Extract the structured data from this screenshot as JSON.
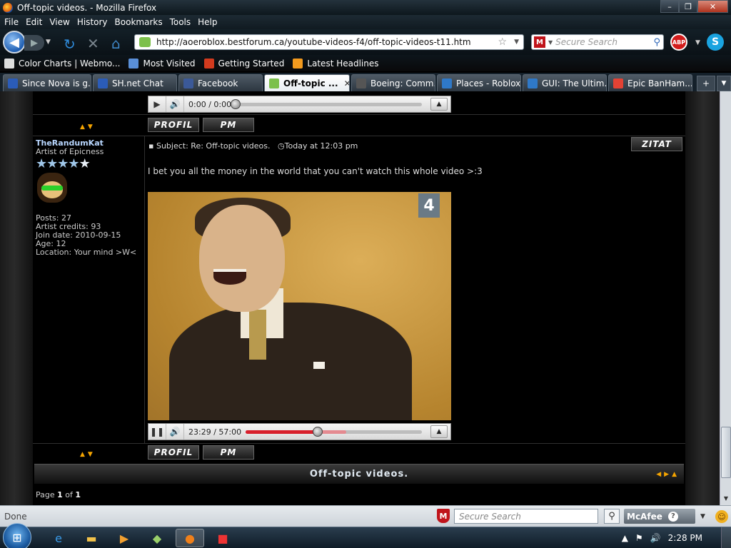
{
  "window": {
    "title": "Off-topic videos. - Mozilla Firefox",
    "min": "–",
    "max": "❐",
    "close": "✕"
  },
  "menu": [
    "File",
    "Edit",
    "View",
    "History",
    "Bookmarks",
    "Tools",
    "Help"
  ],
  "nav": {
    "url": "http://aoeroblox.bestforum.ca/youtube-videos-f4/off-topic-videos-t11.htm",
    "search_placeholder": "Secure Search",
    "abp_label": "ABP"
  },
  "bookmarks": [
    {
      "label": "Color Charts | Webmo...",
      "color": "#dddddd"
    },
    {
      "label": "Most Visited",
      "color": "#5a8fd8"
    },
    {
      "label": "Getting Started",
      "color": "#d23a1e"
    },
    {
      "label": "Latest Headlines",
      "color": "#f39a1e"
    }
  ],
  "tabs": [
    {
      "label": "Since Nova is g...",
      "color": "#2b5cb8",
      "active": false
    },
    {
      "label": "SH.net Chat",
      "color": "#2b5cb8",
      "active": false
    },
    {
      "label": "Facebook",
      "color": "#3b5998",
      "active": false
    },
    {
      "label": "Off-topic ...",
      "color": "#7cc04b",
      "active": true
    },
    {
      "label": "Boeing: Comm...",
      "color": "#555555",
      "active": false
    },
    {
      "label": "Places - Roblox...",
      "color": "#2f79c8",
      "active": false
    },
    {
      "label": "GUI: The Ultim...",
      "color": "#2f79c8",
      "active": false
    },
    {
      "label": "Epic BanHam...",
      "color": "#e34234",
      "active": false
    }
  ],
  "top_player": {
    "time": "0:00 / 0:00",
    "progress": 0.0
  },
  "post_buttons": {
    "profile": "PROFIL",
    "pm": "PM",
    "quote": "ZITAT"
  },
  "post": {
    "username": "TheRandumKat",
    "rank": "Artist of Epicness",
    "stars": 5,
    "stats": [
      "Posts: 27",
      "Artist credits: 93",
      "Join date: 2010-09-15",
      "Age: 12",
      "Location: Your mind >W<"
    ],
    "subject": "Subject: Re: Off-topic videos.",
    "time": "Today at 12:03 pm",
    "text": "I bet you all the money in the world that you can't watch this whole video >:3",
    "video_channel_logo": "4"
  },
  "video_player": {
    "time": "23:29 / 57:00",
    "progress": 0.41,
    "buffered": 0.57
  },
  "topic_footer": {
    "title": "Off-topic videos.",
    "page_label": "Page",
    "page_current": "1",
    "page_of": "of",
    "page_total": "1"
  },
  "status": {
    "text": "Done",
    "search_placeholder": "Secure Search",
    "mcafee_label": "McAfee"
  },
  "taskbar": {
    "clock": "2:28 PM"
  }
}
